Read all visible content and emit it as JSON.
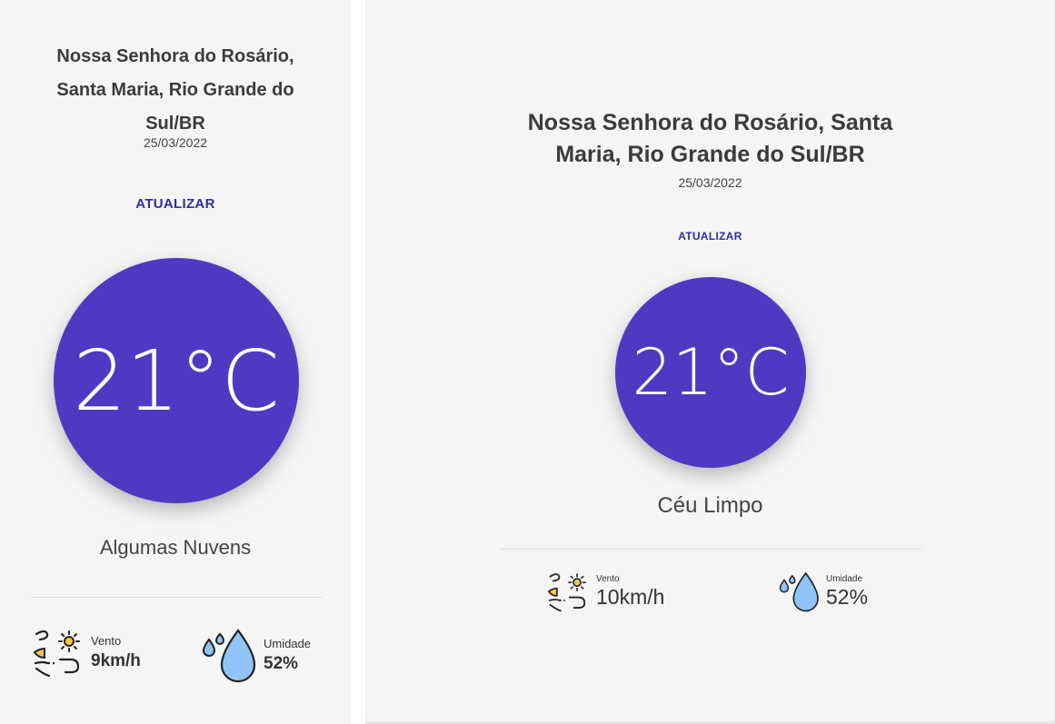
{
  "colors": {
    "accent": "#5039c2",
    "link": "#2e2ea0",
    "background": "#f5f5f5",
    "water": "#90c4f9",
    "sun": "#f6c64b"
  },
  "icons": {
    "wind": "wind-sun-icon",
    "humidity": "water-drops-icon"
  },
  "left": {
    "location_lines": [
      "Nossa Senhora do Rosário,",
      "Santa Maria, Rio Grande do",
      "Sul/BR"
    ],
    "date": "25/03/2022",
    "refresh_label": "ATUALIZAR",
    "temperature": "21°C",
    "condition": "Algumas Nuvens",
    "wind": {
      "label": "Vento",
      "value": "9km/h"
    },
    "humidity": {
      "label": "Umidade",
      "value": "52%"
    }
  },
  "right": {
    "location_lines": [
      "Nossa Senhora do Rosário, Santa",
      "Maria, Rio Grande do Sul/BR"
    ],
    "date": "25/03/2022",
    "refresh_label": "ATUALIZAR",
    "temperature": "21°C",
    "condition": "Céu Limpo",
    "wind": {
      "label": "Vento",
      "value": "10km/h"
    },
    "humidity": {
      "label": "Umidade",
      "value": "52%"
    }
  }
}
